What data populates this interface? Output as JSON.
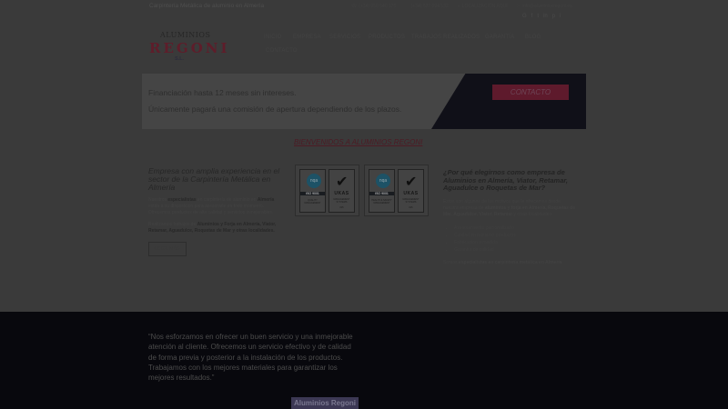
{
  "topbar": {
    "tagline": "Carpintería Metálica de aluminio en Almería",
    "phone1": "(+34) 950 640 175",
    "phone2": "(+34) 637 094 532",
    "location": "LOCALIZACIÓN AQUÍ",
    "email": "info@aluminiosregoni.es",
    "socials": [
      "G",
      "f",
      "t",
      "in",
      "p",
      "i"
    ]
  },
  "logo": {
    "line1": "ALUMINIOS",
    "line2": "REGONI",
    "line3": "S.L."
  },
  "nav": {
    "items": [
      "INICIO",
      "EMPRESA",
      "SERVICIOS",
      "PRODUCTOS",
      "TRABAJOS REALIZADOS",
      "GARANTÍA",
      "BLOG",
      "CONTACTO"
    ]
  },
  "banner": {
    "line1": "Financiación hasta 12 meses sin intereses.",
    "line2": "Únicamente pagará una comisión de apertura dependiendo de los plazos.",
    "cta": "CONTACTO"
  },
  "welcome": "BIENVENIDOS A ALUMINIOS REGONI",
  "col1": {
    "heading": "Empresa con amplia experiencia en el sector de la Carpintería Metálica en Almería",
    "p1_a": "Nuestros ",
    "p1_b": "especialistas",
    "p1_c": " en carpintería de aluminio en ",
    "p1_d": "Almería",
    "p1_e": " están a su disposición para asesorarle en todo momento. Ofrecemos productos de alta calidad y servicios inmejorables.",
    "p2_a": "Realizamos trabajos de ",
    "p2_b": "Aluminios y Forja en Almería, Viator, Retamar, Aguadulce, Roquetas de Mar y otras localidades.",
    "more": "LEER MÁS"
  },
  "certs": {
    "nqa": "nqa",
    "iso": "ISO 9001",
    "qm": "QUALITY MANAGEMENT",
    "hs": "HEALTH & SAFETY MANAGEMENT",
    "ukas": "UKAS",
    "ms": "MANAGEMENT SYSTEMS",
    "n1": "015",
    "n2": "015"
  },
  "col3": {
    "heading": "¿Por qué elegirnos como empresa de Aluminios en Almería, Viator, Retamar, Aguadulce o Roquetas de Mar?",
    "p1_a": "Estos son algunos de los motivos que le ofrecemos desde nuestra empresa de ",
    "p1_b": "aluminios y forja en Almería, Roquetas de Mar, Aguadulce, Viator, Retamar",
    "p1_c": " y otras localidades:",
    "list": [
      "Asesoramiento personalizado",
      "Calidad en nuestros productos",
      "Fabricación a medida",
      "Garantía de calidad"
    ],
    "p2_a": "Somos ",
    "p2_b": "especialistas en carpintería metálica en Almería"
  },
  "footer": {
    "quote": "“Nos esforzamos en ofrecer un buen servicio y una inmejorable atención al cliente. Ofrecemos un servicio efectivo y de calidad de forma previa y posterior a la instalación de los productos. Trabajamos con los mejores materiales para garantizar los mejores resultados.”",
    "brand": "Aluminios Regoni"
  }
}
